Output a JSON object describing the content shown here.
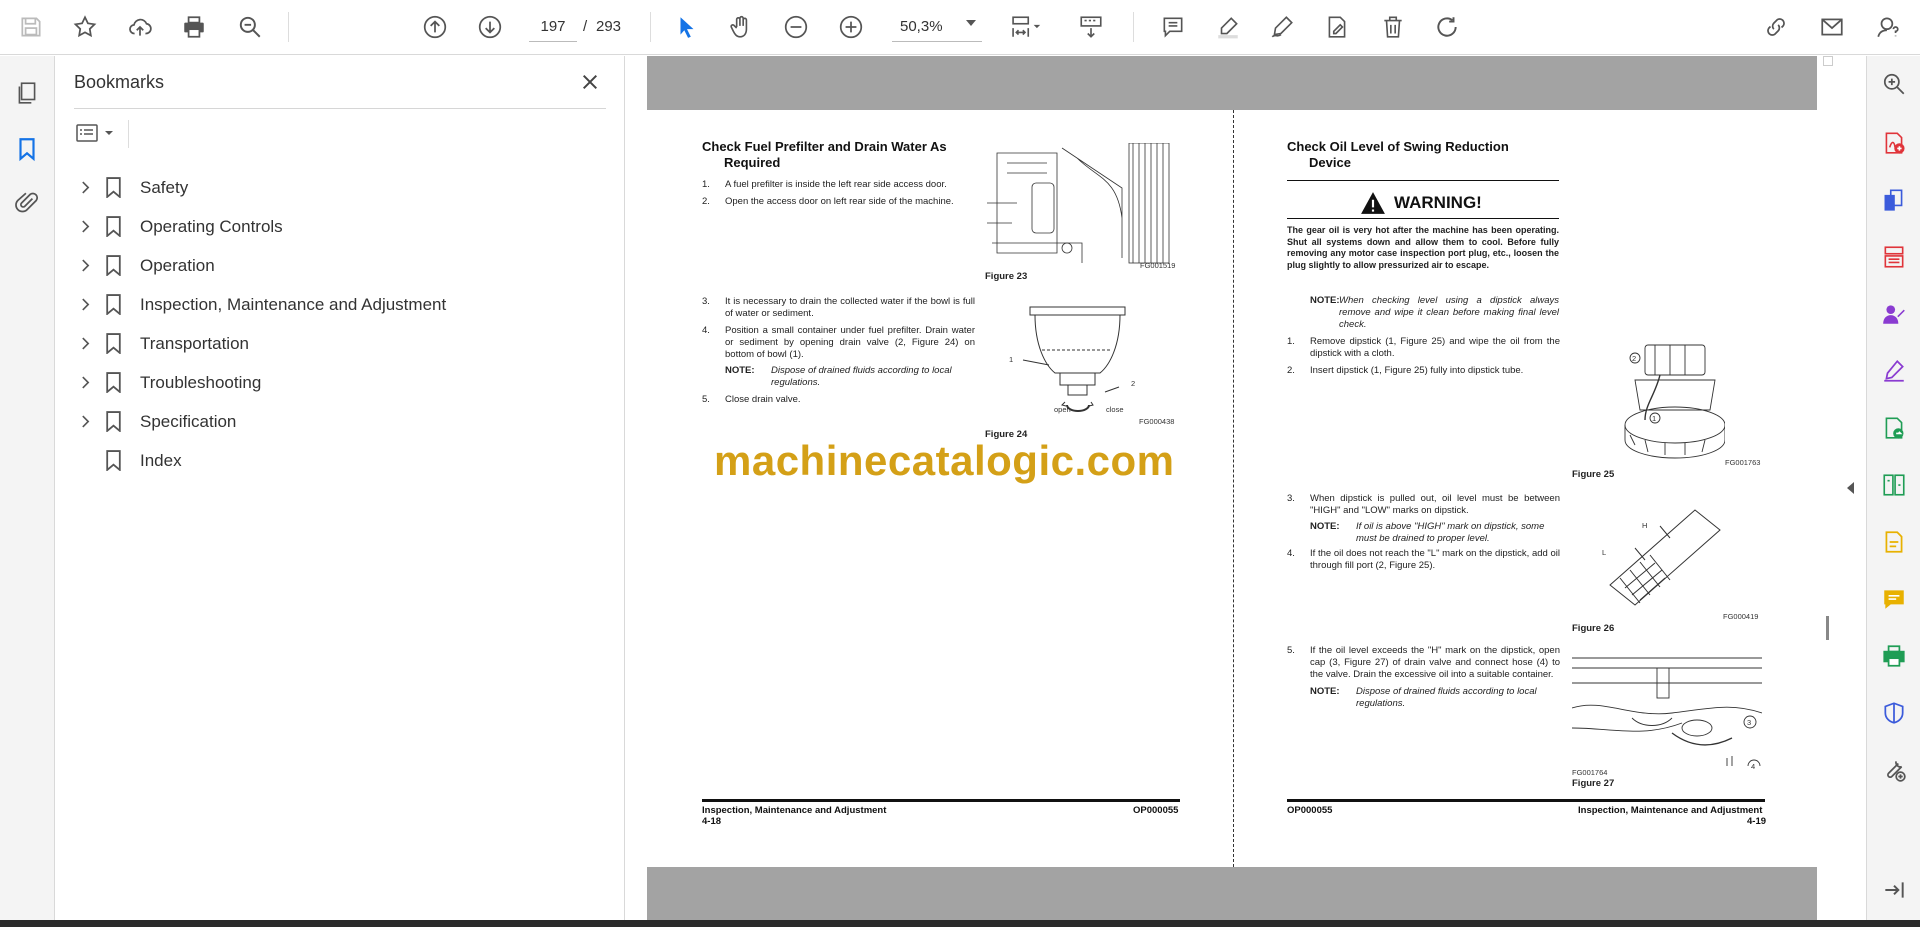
{
  "toolbar": {
    "page_current": "197",
    "page_separator": "/",
    "page_total": "293",
    "zoom": "50,3%"
  },
  "bookmarks": {
    "title": "Bookmarks",
    "items": [
      {
        "label": "Safety",
        "expandable": true
      },
      {
        "label": "Operating Controls",
        "expandable": true
      },
      {
        "label": "Operation",
        "expandable": true
      },
      {
        "label": "Inspection, Maintenance and Adjustment",
        "expandable": true
      },
      {
        "label": "Transportation",
        "expandable": true
      },
      {
        "label": "Troubleshooting",
        "expandable": true
      },
      {
        "label": "Specification",
        "expandable": true
      },
      {
        "label": "Index",
        "expandable": false
      }
    ]
  },
  "left_page": {
    "heading_line1": "Check Fuel Prefilter and Drain Water As",
    "heading_line2": "Required",
    "steps": [
      {
        "n": "1.",
        "text": "A fuel prefilter is inside the left rear side access door."
      },
      {
        "n": "2.",
        "text": "Open the access door on left rear side of the machine."
      },
      {
        "n": "3.",
        "text": "It is necessary to drain the collected water if the bowl is full of water or sediment."
      },
      {
        "n": "4.",
        "text": "Position a small container under fuel prefilter. Drain water or sediment by opening drain valve (2, Figure 24) on bottom of bowl (1)."
      },
      {
        "n": "5.",
        "text": "Close drain valve."
      }
    ],
    "note_label": "NOTE:",
    "note_text": "Dispose of drained fluids according to local regulations.",
    "fig23_caption": "Figure 23",
    "fig23_code": "FG001519",
    "fig24_caption": "Figure 24",
    "fig24_code": "FG000438",
    "fig24_label_1": "1",
    "fig24_label_2": "2",
    "fig24_open": "open",
    "fig24_close": "close",
    "footer_left_title": "Inspection, Maintenance and Adjustment",
    "footer_left_page": "4-18",
    "footer_right_code": "OP000055"
  },
  "right_page": {
    "heading_line1": "Check Oil Level of Swing Reduction",
    "heading_line2": "Device",
    "warning_title": "WARNING!",
    "warning_text": "The gear oil is very hot after the machine has been operating. Shut all systems down and allow them to cool. Before fully removing any motor case inspection port plug, etc., loosen the plug slightly to allow pressurized air to escape.",
    "note1_label": "NOTE:",
    "note1_text": "When checking level using a dipstick always remove and wipe it clean before making final level check.",
    "steps": [
      {
        "n": "1.",
        "text": "Remove dipstick (1, Figure 25) and wipe the oil from the dipstick with a cloth."
      },
      {
        "n": "2.",
        "text": "Insert dipstick (1, Figure 25) fully into dipstick tube."
      },
      {
        "n": "3.",
        "text": "When dipstick is pulled out, oil level must be between \"HIGH\" and \"LOW\" marks on dipstick."
      },
      {
        "n": "4.",
        "text": "If the oil does not reach the \"L\" mark on the dipstick, add oil through fill port (2, Figure 25)."
      },
      {
        "n": "5.",
        "text": "If the oil level exceeds the \"H\" mark on the dipstick, open cap (3, Figure 27) of drain valve and connect hose (4) to the valve. Drain the excessive oil into a suitable container."
      }
    ],
    "note2_label": "NOTE:",
    "note2_text": "If oil is above \"HIGH\" mark on dipstick, some must be drained to proper level.",
    "note3_label": "NOTE:",
    "note3_text": "Dispose of drained fluids according to local regulations.",
    "fig25_caption": "Figure 25",
    "fig25_code": "FG001763",
    "fig26_caption": "Figure 26",
    "fig26_code": "FG000419",
    "fig27_caption": "Figure 27",
    "fig27_code": "FG001764",
    "fig26_h": "H",
    "fig26_l": "L",
    "fig_label_1": "1",
    "fig_label_2": "2",
    "fig_label_3": "3",
    "fig_label_4": "4",
    "footer_left_code": "OP000055",
    "footer_right_title": "Inspection, Maintenance and Adjustment",
    "footer_right_page": "4-19"
  },
  "watermark": "machinecatalogic.com",
  "colors": {
    "accent": "#1473e6",
    "watermark": "#d4a017",
    "rail_icon_purple": "#8a3bd1",
    "rail_icon_red": "#e0343a",
    "rail_icon_green": "#1f9d55",
    "rail_icon_yellow": "#e8b100",
    "rail_icon_blue": "#3b5bdb"
  }
}
